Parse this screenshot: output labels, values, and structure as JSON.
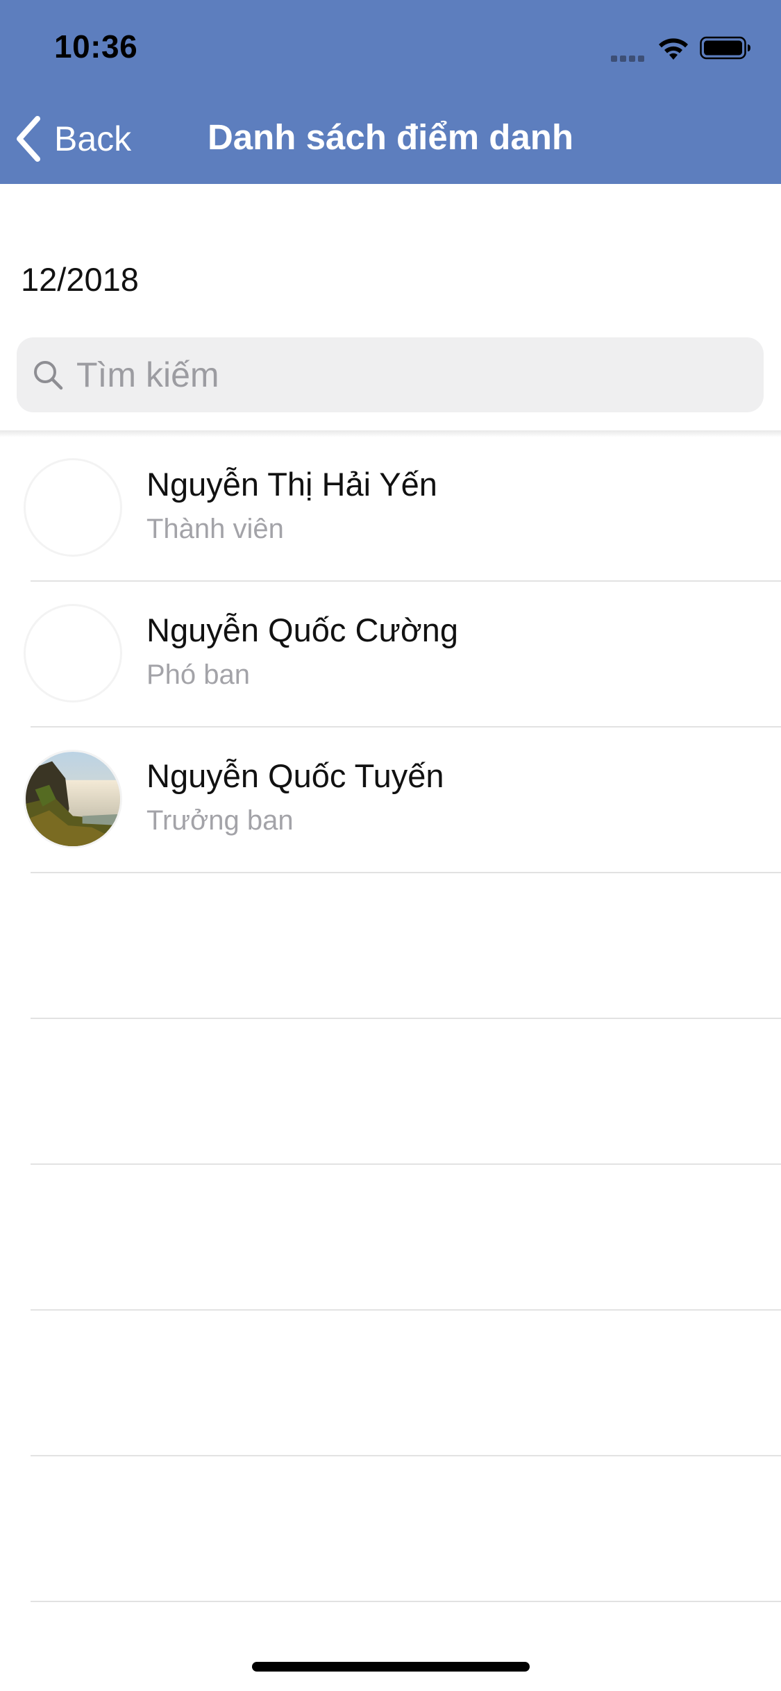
{
  "status_bar": {
    "time": "10:36",
    "signal_icon": "signal-dots-icon",
    "wifi_icon": "wifi-icon",
    "battery_icon": "battery-icon"
  },
  "nav": {
    "back_label": "Back",
    "back_icon": "chevron-left-icon",
    "title": "Danh sách điểm danh",
    "bar_color": "#5d7ebe"
  },
  "date": "12/2018",
  "search": {
    "placeholder": "Tìm kiếm",
    "value": "",
    "icon": "search-icon"
  },
  "members": [
    {
      "name": "Nguyễn Thị Hải Yến",
      "role": "Thành viên",
      "avatar": "empty"
    },
    {
      "name": "Nguyễn Quốc Cường",
      "role": "Phó ban",
      "avatar": "empty"
    },
    {
      "name": "Nguyễn Quốc Tuyến",
      "role": "Trưởng ban",
      "avatar": "waterfall-photo"
    }
  ]
}
